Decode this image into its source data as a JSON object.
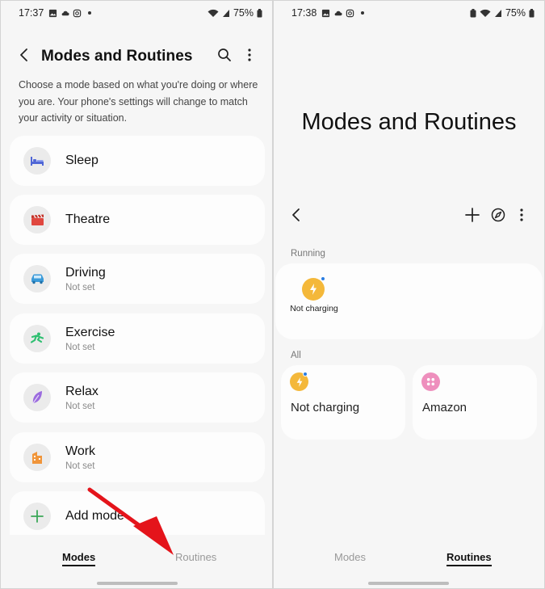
{
  "left": {
    "status": {
      "time": "17:37",
      "battery": "75%"
    },
    "header": {
      "title": "Modes and Routines"
    },
    "description": "Choose a mode based on what you're doing or where you are. Your phone's settings will change to match your activity or situation.",
    "modes": [
      {
        "name": "Sleep",
        "sub": ""
      },
      {
        "name": "Theatre",
        "sub": ""
      },
      {
        "name": "Driving",
        "sub": "Not set"
      },
      {
        "name": "Exercise",
        "sub": "Not set"
      },
      {
        "name": "Relax",
        "sub": "Not set"
      },
      {
        "name": "Work",
        "sub": "Not set"
      }
    ],
    "add_mode": "Add mode",
    "nav": {
      "modes": "Modes",
      "routines": "Routines"
    }
  },
  "right": {
    "status": {
      "time": "17:38",
      "battery": "75%"
    },
    "title": "Modes and Routines",
    "running_label": "Running",
    "running": [
      {
        "name": "Not charging"
      }
    ],
    "all_label": "All",
    "all": [
      {
        "name": "Not charging"
      },
      {
        "name": "Amazon"
      }
    ],
    "nav": {
      "modes": "Modes",
      "routines": "Routines"
    }
  },
  "colors": {
    "bolt": "#f4b83a",
    "badge": "#2a7de1",
    "amazon": "#ee8fbd",
    "arrow": "#e4141b",
    "add": "#3aa757"
  },
  "icons": {
    "sleep": "bed-icon",
    "theatre": "clapperboard-icon",
    "driving": "car-icon",
    "exercise": "running-person-icon",
    "relax": "leaf-icon",
    "work": "building-icon"
  }
}
